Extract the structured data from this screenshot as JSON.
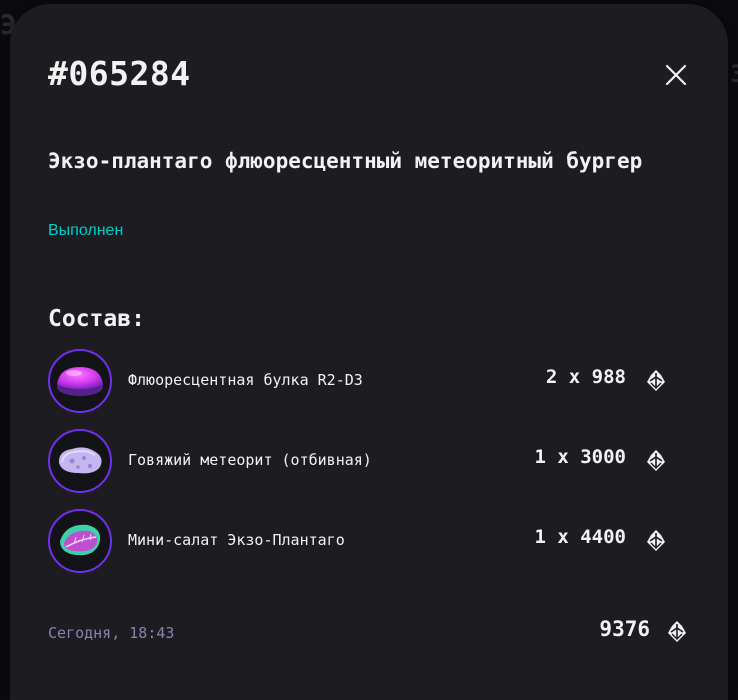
{
  "order": {
    "number": "#065284",
    "name": "Экзо-плантаго флюоресцентный метеоритный бургер",
    "status": "Выполнен",
    "status_color": "#00cccc"
  },
  "ingredients": {
    "title": "Состав:",
    "items": [
      {
        "name": "Флюоресцентная булка R2-D3",
        "price": "2 x 988",
        "icon": "fluorescent-bun"
      },
      {
        "name": "Говяжий метеорит (отбивная)",
        "price": "1 x 3000",
        "icon": "beef-meteorite"
      },
      {
        "name": "Мини-салат Экзо-Плантаго",
        "price": "1 x 4400",
        "icon": "mini-salad"
      }
    ]
  },
  "footer": {
    "date": "Сегодня, 18:43",
    "total": "9376"
  },
  "colors": {
    "modal_bg": "#1c1c21",
    "accent_border": "#6f31ec",
    "muted_text": "#8585ad"
  },
  "icons": {
    "close": "close-icon",
    "currency": "currency-icon"
  }
}
